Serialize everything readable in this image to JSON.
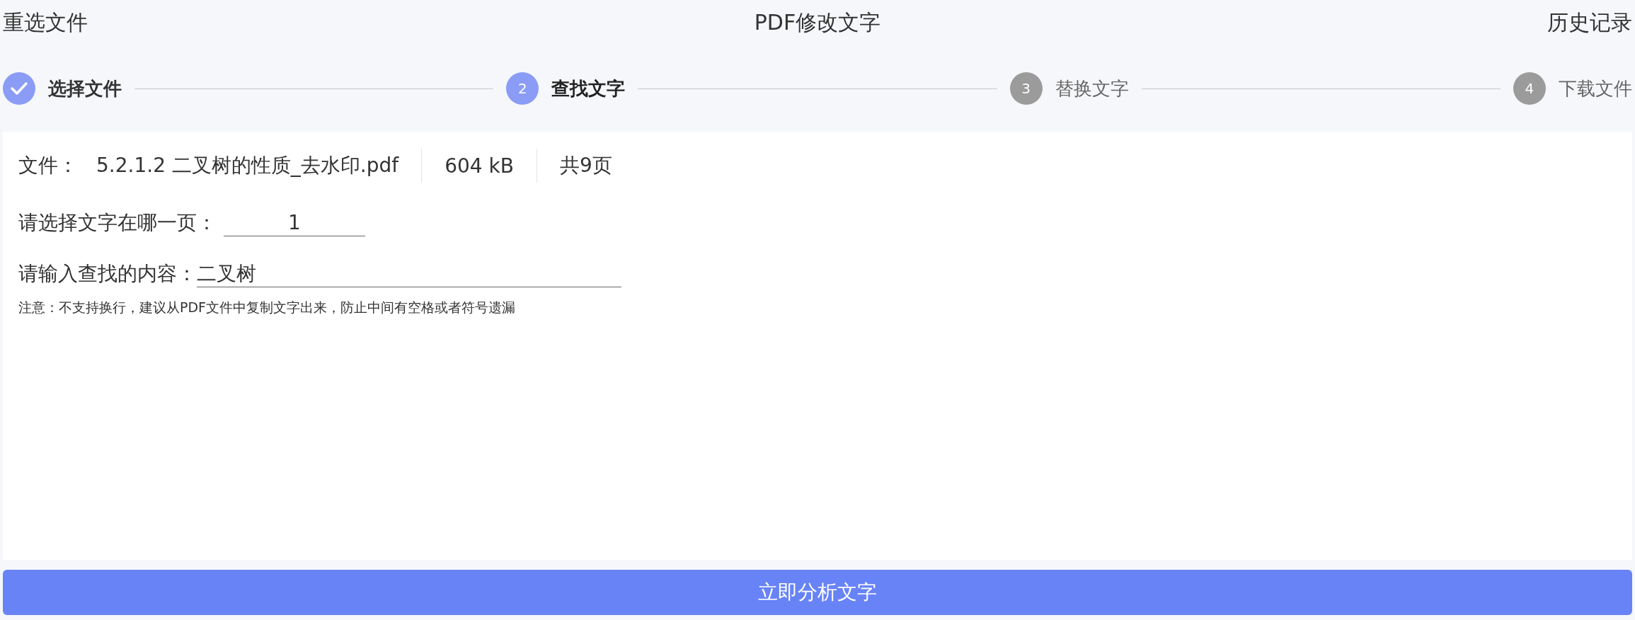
{
  "header": {
    "reselect": "重选文件",
    "title": "PDF修改文字",
    "history": "历史记录"
  },
  "steps": [
    {
      "done": true,
      "selected": false,
      "label": "选择文件"
    },
    {
      "done": false,
      "selected": true,
      "number": "2",
      "label": "查找文字"
    },
    {
      "done": false,
      "selected": false,
      "number": "3",
      "label": "替换文字"
    },
    {
      "done": false,
      "selected": false,
      "number": "4",
      "label": "下载文件"
    }
  ],
  "file": {
    "label": "文件：",
    "name": "5.2.1.2 二叉树的性质_去水印.pdf",
    "size": "604 kB",
    "pages": "共9页"
  },
  "page_field": {
    "label": "请选择文字在哪一页：",
    "value": "1"
  },
  "query_field": {
    "label": "请输入查找的内容：",
    "value": "二叉树"
  },
  "note": "注意：不支持换行，建议从PDF文件中复制文字出来，防止中间有空格或者符号遗漏",
  "button": "立即分析文字"
}
